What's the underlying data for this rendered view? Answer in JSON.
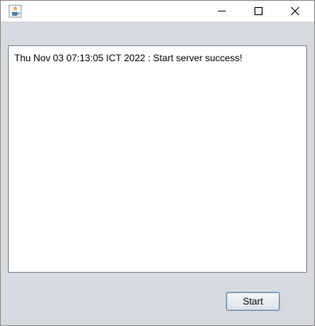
{
  "window": {
    "title": "",
    "app_icon": "java-coffee-cup-icon",
    "controls": {
      "minimize_icon": "minimize-icon",
      "maximize_icon": "maximize-icon",
      "close_icon": "close-icon"
    }
  },
  "log": {
    "lines": [
      "Thu Nov 03 07:13:05 ICT 2022 : Start server success!"
    ]
  },
  "actions": {
    "start_label": "Start"
  },
  "colors": {
    "window_bg": "#d6d9df",
    "titlebar_bg": "#ffffff",
    "text": "#000000",
    "field_border": "#7a8a99"
  }
}
